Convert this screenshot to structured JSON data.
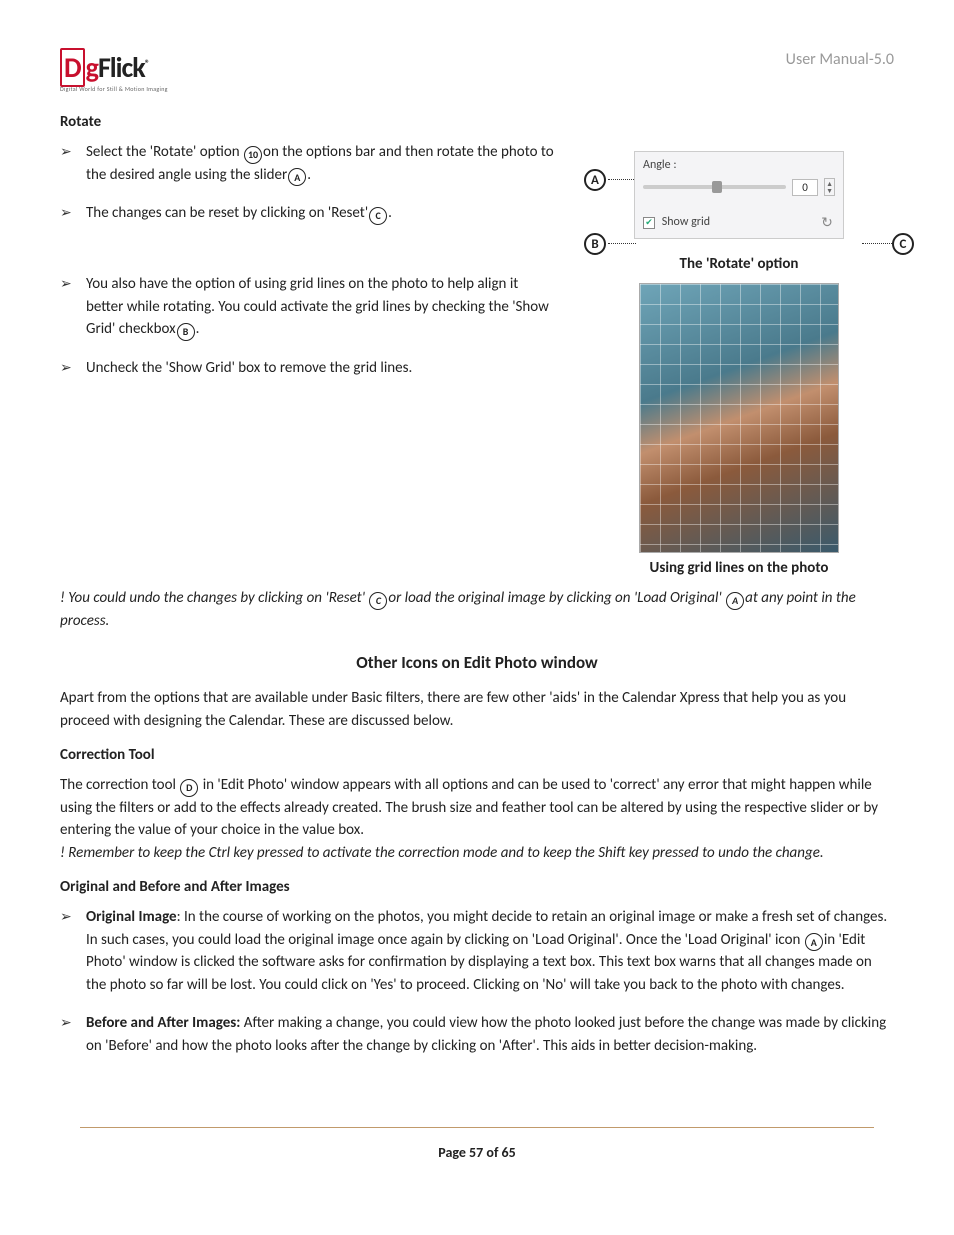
{
  "header": {
    "logo_d": "D",
    "logo_o": "g",
    "logo_flick": "Flick",
    "logo_tag": "Digital World for Still & Motion Imaging",
    "manual": "User Manual-5.0"
  },
  "rotate": {
    "title": "Rotate",
    "bullets": [
      {
        "pre": "Select the 'Rotate' option ",
        "icon": "10",
        "mid": "on the options bar and then rotate the photo to the desired angle using the slider",
        "icon2": "A",
        "post": "."
      },
      {
        "pre": "The changes can be reset by clicking on 'Reset'",
        "icon": "C",
        "post": "."
      },
      {
        "pre": "You also have the option of using grid lines on the photo to help align it better while rotating. You could activate the grid lines by checking the 'Show Grid' checkbox",
        "icon": "B",
        "post": "."
      },
      {
        "pre": "Uncheck the 'Show Grid' box to remove the grid lines."
      }
    ],
    "panel": {
      "angle_label": "Angle :",
      "value": "0",
      "show_grid": "Show grid",
      "marker_a": "A",
      "marker_b": "B",
      "marker_c": "C"
    },
    "caption1": "The 'Rotate' option",
    "caption2": "Using grid lines on the photo"
  },
  "note1": {
    "pre": "! You could undo the changes by clicking on 'Reset' ",
    "icon1": "C",
    "mid": "or load the original image by clicking on 'Load Original' ",
    "icon2": "A",
    "post": "at any point in the process."
  },
  "other": {
    "heading": "Other Icons on Edit Photo window",
    "intro": "Apart from the options that are available under Basic filters, there are few other 'aids' in the Calendar Xpress that help you as you proceed with designing the Calendar. These are discussed below.",
    "correction_title": "Correction Tool",
    "correction_pre": "The correction tool ",
    "correction_icon": "D",
    "correction_post": " in 'Edit Photo' window appears with all options and can be used to 'correct' any error that might happen while using the filters or add to the effects already created. The brush size and feather tool can be altered by using the respective slider or by entering the value of your choice in the value box.",
    "correction_note": "! Remember to keep the Ctrl key pressed to activate the correction mode and to keep the Shift key pressed to undo the change.",
    "oba_title": "Original and Before and After Images",
    "bullets": [
      {
        "bold": "Original Image",
        "pre": ": In the course of working on the photos, you might decide to retain an original image or make a fresh set of changes. In such cases, you could load the original image once again by clicking on 'Load Original'. Once the 'Load Original' icon ",
        "icon": "A",
        "post": "in 'Edit Photo' window is clicked the software asks for confirmation by displaying a text box. This text box warns that all changes made on the photo so far will be lost. You could click on 'Yes' to proceed. Clicking on 'No' will take you back to the photo with changes."
      },
      {
        "bold": "Before and After Images:",
        "pre": " After making a change, you could view how the photo looked just before the change was made by clicking on 'Before' and how the photo looks after the change by clicking on 'After'. This aids in better decision-making."
      }
    ]
  },
  "footer": {
    "page": "Page 57 of 65"
  }
}
